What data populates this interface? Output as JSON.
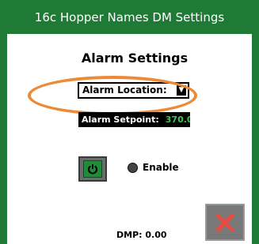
{
  "window": {
    "title": "16c Hopper Names DM Settings"
  },
  "heading": "Alarm Settings",
  "alarm_location": {
    "label": "Alarm Location:",
    "dropdown_icon": "chevron-down-icon"
  },
  "alarm_setpoint": {
    "label": "Alarm Setpoint:",
    "value": "370.0°"
  },
  "power": {
    "icon": "power-icon"
  },
  "enable": {
    "label": "Enable",
    "state": "off"
  },
  "close": {
    "icon": "close-x-icon"
  },
  "dmp": {
    "label": "DMP:",
    "value": "0.00"
  },
  "colors": {
    "frame": "#1f7a36",
    "highlight_ellipse": "#ec8a38",
    "setpoint_value": "#35c84f",
    "close_x": "#e84a42"
  }
}
